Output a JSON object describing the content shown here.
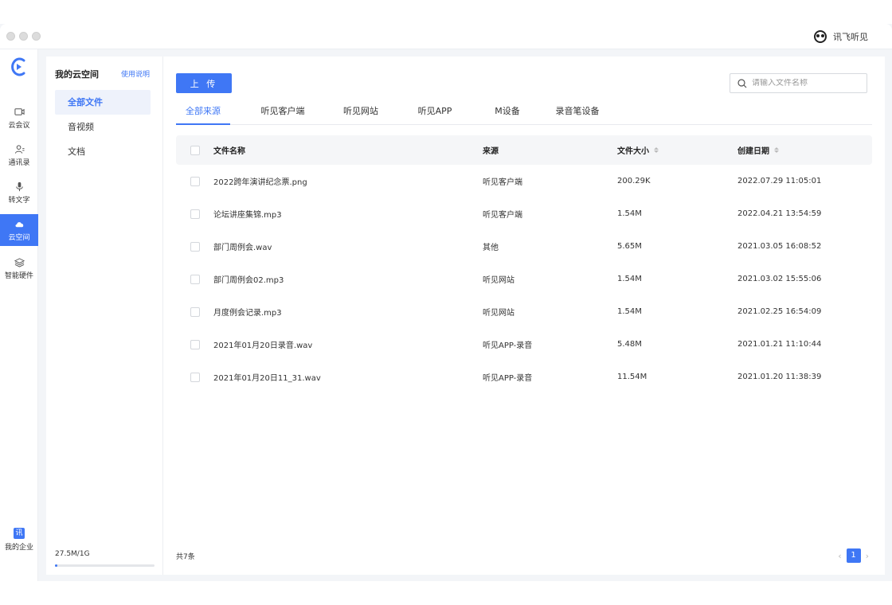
{
  "app": {
    "user_name": "讯飞听见"
  },
  "rail": [
    {
      "label": "云会议",
      "icon": "video-camera-icon"
    },
    {
      "label": "通讯录",
      "icon": "contacts-icon"
    },
    {
      "label": "转文字",
      "icon": "microphone-icon"
    },
    {
      "label": "云空间",
      "icon": "cloud-icon",
      "active": true
    },
    {
      "label": "智能硬件",
      "icon": "layers-icon"
    }
  ],
  "rail_bottom": {
    "badge": "讯",
    "label": "我的企业"
  },
  "space": {
    "title": "我的云空间",
    "help": "使用说明",
    "items": [
      "全部文件",
      "音视频",
      "文档"
    ],
    "quota_text": "27.5M/1G",
    "quota_fraction": 0.027
  },
  "toolbar": {
    "upload_label": "上 传",
    "search_placeholder": "请输入文件名称"
  },
  "tabs": [
    "全部来源",
    "听见客户端",
    "听见网站",
    "听见APP",
    "M设备",
    "录音笔设备"
  ],
  "table": {
    "headers": [
      "文件名称",
      "来源",
      "文件大小",
      "创建日期"
    ],
    "rows": [
      [
        "2022跨年演讲纪念票.png",
        "听见客户端",
        "200.29K",
        "2022.07.29 11:05:01"
      ],
      [
        "论坛讲座集锦.mp3",
        "听见客户端",
        "1.54M",
        "2022.04.21 13:54:59"
      ],
      [
        "部门周例会.wav",
        "其他",
        "5.65M",
        "2021.03.05 16:08:52"
      ],
      [
        "部门周例会02.mp3",
        "听见网站",
        "1.54M",
        "2021.03.02 15:55:06"
      ],
      [
        "月度例会记录.mp3",
        "听见网站",
        "1.54M",
        "2021.02.25 16:54:09"
      ],
      [
        "2021年01月20日录音.wav",
        "听见APP-录音",
        "5.48M",
        "2021.01.21 11:10:44"
      ],
      [
        "2021年01月20日11_31.wav",
        "听见APP-录音",
        "11.54M",
        "2021.01.20 11:38:39"
      ]
    ]
  },
  "footer": {
    "total": "共7条",
    "page": "1"
  },
  "colors": {
    "accent": "#3f77f5"
  }
}
